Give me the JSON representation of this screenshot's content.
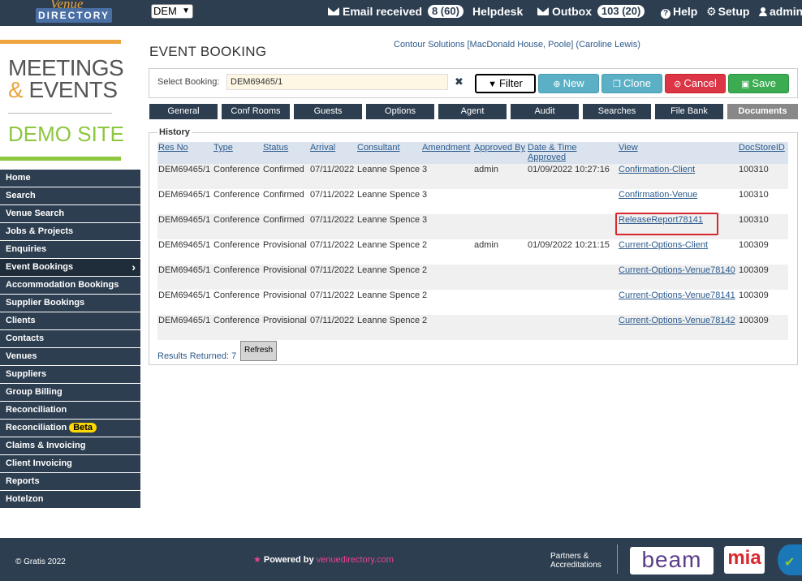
{
  "topbar": {
    "logo_top": "Venue",
    "logo_bottom": "DIRECTORY",
    "org_select": "DEM",
    "email_label": "Email received",
    "email_count": "8 (60)",
    "helpdesk": "Helpdesk",
    "outbox_label": "Outbox",
    "outbox_count": "103 (20)",
    "help": "Help",
    "setup": "Setup",
    "user": "admin"
  },
  "brand": {
    "line1": "MEETINGS",
    "amp": "&",
    "line2": "EVENTS",
    "line3": "DEMO SITE"
  },
  "sidebar": {
    "items": [
      {
        "label": "Home"
      },
      {
        "label": "Search"
      },
      {
        "label": "Venue Search"
      },
      {
        "label": "Jobs & Projects"
      },
      {
        "label": "Enquiries"
      },
      {
        "label": "Event Bookings"
      },
      {
        "label": "Accommodation Bookings"
      },
      {
        "label": "Supplier Bookings"
      },
      {
        "label": "Clients"
      },
      {
        "label": "Contacts"
      },
      {
        "label": "Venues"
      },
      {
        "label": "Suppliers"
      },
      {
        "label": "Group Billing"
      },
      {
        "label": "Reconciliation"
      },
      {
        "label": "Reconciliation"
      },
      {
        "label": "Claims & Invoicing"
      },
      {
        "label": "Client Invoicing"
      },
      {
        "label": "Reports"
      },
      {
        "label": "Hotelzon"
      }
    ],
    "beta_label": "Beta"
  },
  "main": {
    "title": "EVENT BOOKING",
    "context": "Contour Solutions [MacDonald House, Poole] (Caroline Lewis)",
    "select_booking_label": "Select Booking:",
    "select_booking_value": "DEM69465/1",
    "buttons": {
      "filter": "Filter",
      "new": "New",
      "clone": "Clone",
      "cancel": "Cancel",
      "save": "Save"
    },
    "tabs": [
      "General",
      "Conf Rooms",
      "Guests",
      "Options",
      "Agent",
      "Audit",
      "Searches",
      "File Bank",
      "Documents"
    ],
    "history_label": "History",
    "table": {
      "headers": [
        "Res No",
        "Type",
        "Status",
        "Arrival",
        "Consultant",
        "Amendment",
        "Approved By",
        "Date & Time Approved",
        "View",
        "DocStoreID"
      ],
      "rows": [
        [
          "DEM69465/1",
          "Conference",
          "Confirmed",
          "07/11/2022",
          "Leanne Spence",
          "3",
          "admin",
          "01/09/2022 10:27:16",
          "Confirmation-Client",
          "100310"
        ],
        [
          "DEM69465/1",
          "Conference",
          "Confirmed",
          "07/11/2022",
          "Leanne Spence",
          "3",
          "",
          "",
          "Confirmation-Venue",
          "100310"
        ],
        [
          "DEM69465/1",
          "Conference",
          "Confirmed",
          "07/11/2022",
          "Leanne Spence",
          "3",
          "",
          "",
          "ReleaseReport78141",
          "100310"
        ],
        [
          "DEM69465/1",
          "Conference",
          "Provisional",
          "07/11/2022",
          "Leanne Spence",
          "2",
          "admin",
          "01/09/2022 10:21:15",
          "Current-Options-Client",
          "100309"
        ],
        [
          "DEM69465/1",
          "Conference",
          "Provisional",
          "07/11/2022",
          "Leanne Spence",
          "2",
          "",
          "",
          "Current-Options-Venue78140",
          "100309"
        ],
        [
          "DEM69465/1",
          "Conference",
          "Provisional",
          "07/11/2022",
          "Leanne Spence",
          "2",
          "",
          "",
          "Current-Options-Venue78141",
          "100309"
        ],
        [
          "DEM69465/1",
          "Conference",
          "Provisional",
          "07/11/2022",
          "Leanne Spence",
          "2",
          "",
          "",
          "Current-Options-Venue78142",
          "100309"
        ]
      ]
    },
    "results_label": "Results Returned: 7",
    "refresh": "Refresh"
  },
  "footer": {
    "copyright": "© Gratis 2022",
    "powered_by": "Powered by",
    "powered_brand": "venuedirectory.com",
    "partners": "Partners & Accreditations",
    "beam": "beam",
    "mia": "mia"
  }
}
